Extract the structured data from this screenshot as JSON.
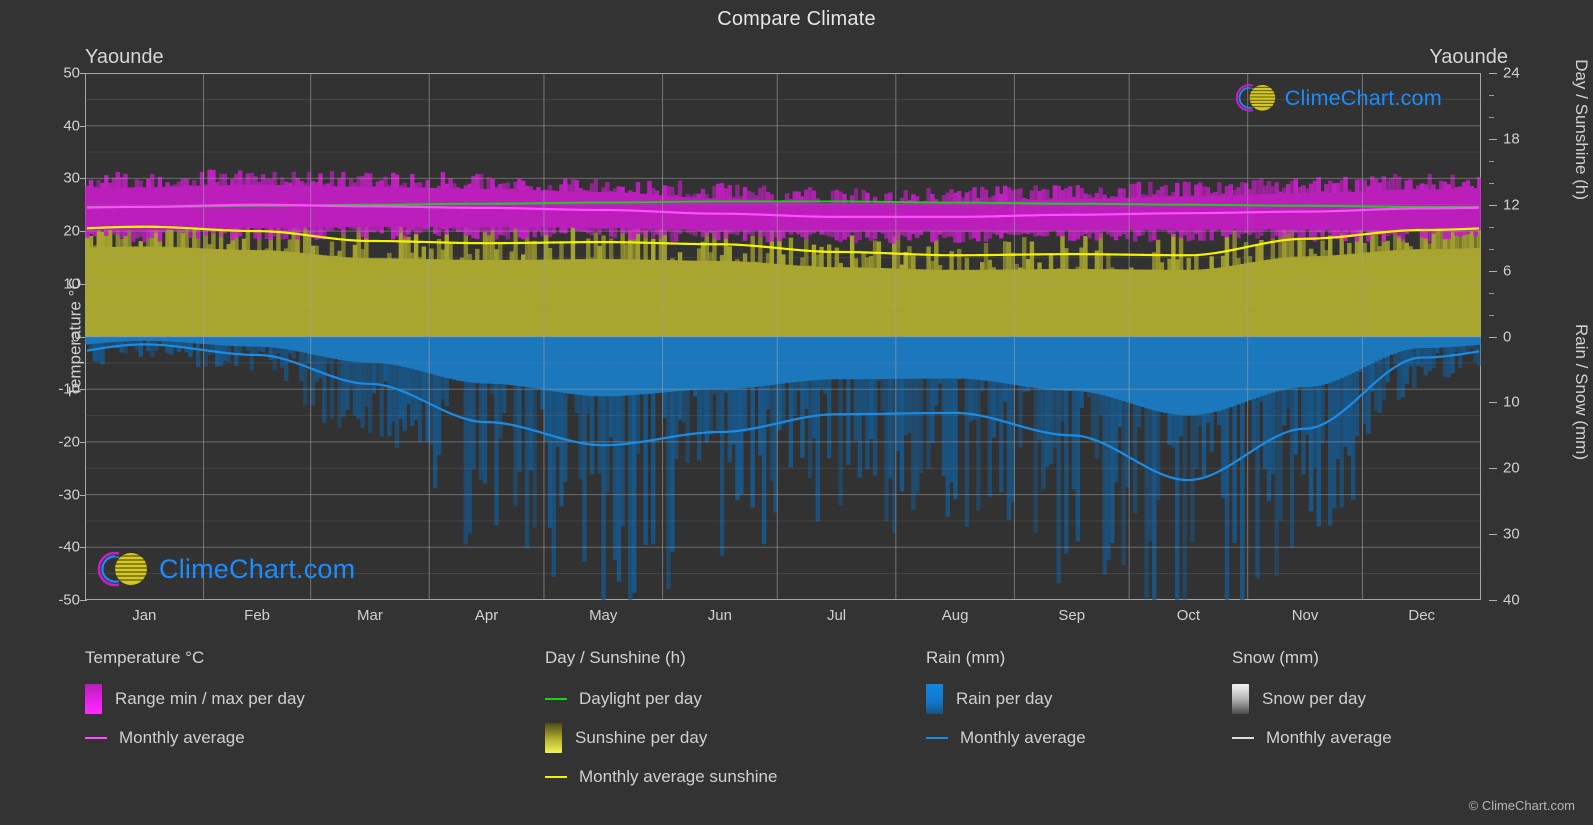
{
  "header": {
    "title": "Compare Climate",
    "city_left": "Yaounde",
    "city_right": "Yaounde"
  },
  "axes": {
    "left_title": "Temperature °C",
    "right_title_top": "Day / Sunshine (h)",
    "right_title_bottom": "Rain / Snow (mm)",
    "left_ticks": [
      "50",
      "40",
      "30",
      "20",
      "10",
      "0",
      "-10",
      "-20",
      "-30",
      "-40",
      "-50"
    ],
    "right_ticks_top": [
      "24",
      "18",
      "12",
      "6",
      "0"
    ],
    "right_ticks_bottom": [
      "10",
      "20",
      "30",
      "40"
    ],
    "x_ticks": [
      "Jan",
      "Feb",
      "Mar",
      "Apr",
      "May",
      "Jun",
      "Jul",
      "Aug",
      "Sep",
      "Oct",
      "Nov",
      "Dec"
    ]
  },
  "legend": {
    "temperature": {
      "heading": "Temperature °C",
      "range_label": "Range min / max per day",
      "avg_label": "Monthly average"
    },
    "sunshine": {
      "heading": "Day / Sunshine (h)",
      "daylight_label": "Daylight per day",
      "sunshine_label": "Sunshine per day",
      "avg_label": "Monthly average sunshine"
    },
    "rain": {
      "heading": "Rain (mm)",
      "per_day_label": "Rain per day",
      "avg_label": "Monthly average"
    },
    "snow": {
      "heading": "Snow (mm)",
      "per_day_label": "Snow per day",
      "avg_label": "Monthly average"
    }
  },
  "watermark": {
    "text": "ClimeChart.com"
  },
  "copyright": "© ClimeChart.com",
  "colors": {
    "background": "#333333",
    "plot_background": "#323232",
    "grid": "#a0a0a0",
    "temp_range": "#cc22cc",
    "temp_avg": "#ff4dff",
    "daylight": "#14d414",
    "sunshine_area": "#a8a62e",
    "sunshine_avg": "#f2f200",
    "rain_area": "#1a6fb0",
    "rain_avg": "#1a8ce6",
    "snow": "#e6e6e6",
    "text": "#d0d0d0",
    "brand": "#1a8cff"
  },
  "chart_data": {
    "type": "area",
    "title": "Compare Climate",
    "subtitle": "Yaounde",
    "xlabel": "",
    "ylabel": "Temperature °C",
    "ylabel_right_top": "Day / Sunshine (h)",
    "ylabel_right_bottom": "Rain / Snow (mm)",
    "grid": true,
    "legend_position": "bottom",
    "ylim_temperature": [
      -50,
      50
    ],
    "ylim_day_sunshine": [
      0,
      24
    ],
    "ylim_rain_snow": [
      0,
      40
    ],
    "categories": [
      "Jan",
      "Feb",
      "Mar",
      "Apr",
      "May",
      "Jun",
      "Jul",
      "Aug",
      "Sep",
      "Oct",
      "Nov",
      "Dec"
    ],
    "series": [
      {
        "name": "Monthly average temperature",
        "unit": "°C",
        "axis": "left",
        "color": "#ff4dff",
        "values": [
          24.6,
          25.0,
          24.7,
          24.4,
          24.0,
          23.3,
          22.7,
          22.7,
          23.1,
          23.4,
          23.7,
          24.3
        ]
      },
      {
        "name": "Range max per day",
        "unit": "°C",
        "axis": "left",
        "color": "#cc22cc",
        "values": [
          29.5,
          30.0,
          29.6,
          29.2,
          28.6,
          27.4,
          26.5,
          26.5,
          27.3,
          27.8,
          28.4,
          29.1
        ]
      },
      {
        "name": "Range min per day",
        "unit": "°C",
        "axis": "left",
        "color": "#cc22cc",
        "values": [
          19.2,
          19.6,
          19.8,
          19.8,
          19.6,
          19.2,
          19.0,
          19.0,
          19.1,
          19.3,
          19.3,
          19.2
        ]
      },
      {
        "name": "Daylight per day",
        "unit": "h",
        "axis": "right_top",
        "color": "#14d414",
        "values": [
          11.8,
          11.9,
          12.0,
          12.1,
          12.2,
          12.3,
          12.3,
          12.2,
          12.1,
          12.0,
          11.9,
          11.8
        ]
      },
      {
        "name": "Monthly average sunshine",
        "unit": "h",
        "axis": "right_top",
        "color": "#f2f200",
        "values": [
          10.0,
          9.6,
          8.7,
          8.5,
          8.6,
          8.4,
          7.7,
          7.4,
          7.5,
          7.4,
          8.9,
          9.7
        ]
      },
      {
        "name": "Monthly average rain",
        "unit": "mm",
        "axis": "right_bottom",
        "color": "#1a8ce6",
        "values": [
          1.2,
          2.8,
          7.2,
          13.0,
          16.5,
          14.5,
          11.8,
          11.6,
          15.0,
          21.8,
          14.0,
          3.2
        ]
      },
      {
        "name": "Monthly average snow",
        "unit": "mm",
        "axis": "right_bottom",
        "color": "#e6e6e6",
        "values": [
          0,
          0,
          0,
          0,
          0,
          0,
          0,
          0,
          0,
          0,
          0,
          0
        ]
      }
    ]
  }
}
